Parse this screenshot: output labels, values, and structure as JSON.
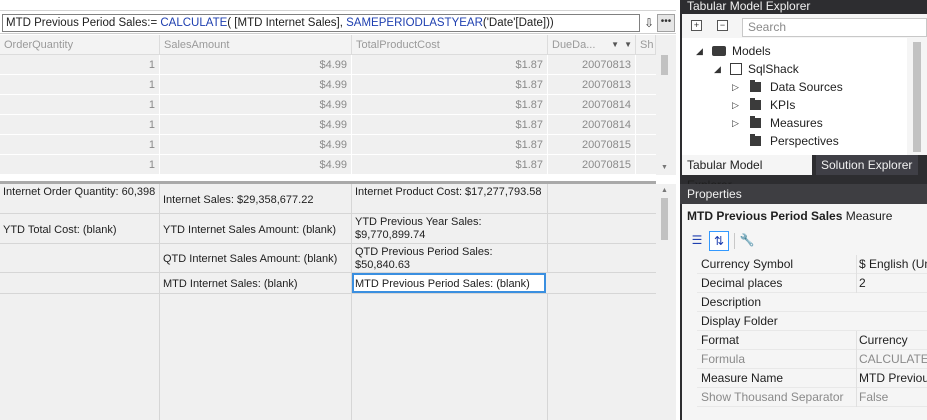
{
  "formula_bar": {
    "measure_name": "MTD Previous Period Sales:=",
    "function": "CALCULATE",
    "arg1": "( [MTD Internet Sales], ",
    "inner_function": "SAMEPERIODLASTYEAR",
    "arg2": "('Date'[Date]))"
  },
  "grid": {
    "columns": [
      "OrderQuantity",
      "SalesAmount",
      "TotalProductCost",
      "DueDa...",
      "Sh"
    ],
    "rows": [
      {
        "qty": "1",
        "sales": "$4.99",
        "cost": "$1.87",
        "due": "20070813"
      },
      {
        "qty": "1",
        "sales": "$4.99",
        "cost": "$1.87",
        "due": "20070813"
      },
      {
        "qty": "1",
        "sales": "$4.99",
        "cost": "$1.87",
        "due": "20070814"
      },
      {
        "qty": "1",
        "sales": "$4.99",
        "cost": "$1.87",
        "due": "20070814"
      },
      {
        "qty": "1",
        "sales": "$4.99",
        "cost": "$1.87",
        "due": "20070815"
      },
      {
        "qty": "1",
        "sales": "$4.99",
        "cost": "$1.87",
        "due": "20070815"
      }
    ]
  },
  "measures": {
    "r1c1": "Internet Order Quantity: 60,398",
    "r1c2": "Internet Sales: $29,358,677.22",
    "r1c3": "Internet Product Cost: $17,277,793.58",
    "r2c1": "YTD Total Cost: (blank)",
    "r2c2": "YTD Internet Sales Amount: (blank)",
    "r2c3": "YTD Previous Year Sales: $9,770,899.74",
    "r3c2": "QTD Internet Sales Amount: (blank)",
    "r3c3": "QTD Previous Period Sales: $50,840.63",
    "r4c2": "MTD Internet Sales: (blank)",
    "r4c3": "MTD Previous Period Sales: (blank)"
  },
  "explorer": {
    "title": "Tabular Model Explorer",
    "search_placeholder": "Search",
    "tree": {
      "models": "Models",
      "model": "SqlShack",
      "children": [
        "Data Sources",
        "KPIs",
        "Measures",
        "Perspectives"
      ]
    },
    "tabs": [
      "Tabular Model Explorer",
      "Solution Explorer"
    ]
  },
  "properties": {
    "title": "Properties",
    "object_name": "MTD Previous Period Sales",
    "object_type": "Measure",
    "rows": [
      {
        "name": "Currency Symbol",
        "value": "$ English (Uni",
        "readonly": false
      },
      {
        "name": "Decimal places",
        "value": "2",
        "readonly": false
      },
      {
        "name": "Description",
        "value": "",
        "readonly": false
      },
      {
        "name": "Display Folder",
        "value": "",
        "readonly": false
      },
      {
        "name": "Format",
        "value": "Currency",
        "readonly": false
      },
      {
        "name": "Formula",
        "value": "CALCULATE(",
        "readonly": true
      },
      {
        "name": "Measure Name",
        "value": "MTD Previous",
        "readonly": false
      },
      {
        "name": "Show Thousand Separator",
        "value": "False",
        "readonly": true
      }
    ]
  },
  "icons": {
    "expand": "expand-icon",
    "overflow": "overflow-icon",
    "wrench": "wrench-icon",
    "categorized": "categorized-icon",
    "alphabetical": "alphabetical-icon"
  }
}
